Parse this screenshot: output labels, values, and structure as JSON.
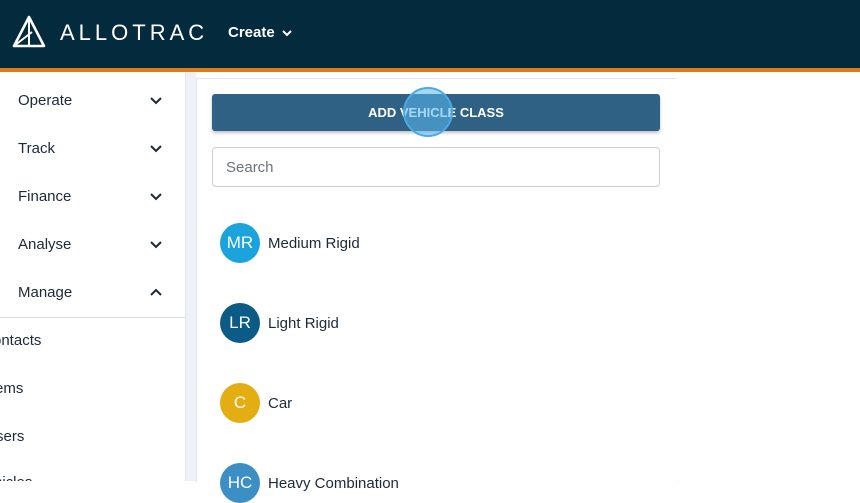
{
  "header": {
    "brand_bold": "ALLO",
    "brand_thin": "TRAC",
    "create_label": "Create"
  },
  "sidebar": {
    "items": [
      {
        "label": "Operate",
        "expanded": false
      },
      {
        "label": "Track",
        "expanded": false
      },
      {
        "label": "Finance",
        "expanded": false
      },
      {
        "label": "Analyse",
        "expanded": false
      },
      {
        "label": "Manage",
        "expanded": true
      }
    ],
    "subitems": [
      "ontacts",
      "ems",
      "sers",
      "hicles"
    ]
  },
  "main": {
    "add_button_label": "ADD VEHICLE CLASS",
    "search_placeholder": "Search",
    "vehicle_classes": [
      {
        "initials": "MR",
        "name": "Medium Rigid",
        "color": "#1aa3dc"
      },
      {
        "initials": "LR",
        "name": "Light Rigid",
        "color": "#0c5a86"
      },
      {
        "initials": "C",
        "name": "Car",
        "color": "#e4ad12"
      },
      {
        "initials": "HC",
        "name": "Heavy Combination",
        "color": "#3b8fc4"
      }
    ]
  },
  "colors": {
    "topbar": "#042a3e",
    "accent_stripe": "#e07b1a",
    "button": "#2f6185"
  }
}
